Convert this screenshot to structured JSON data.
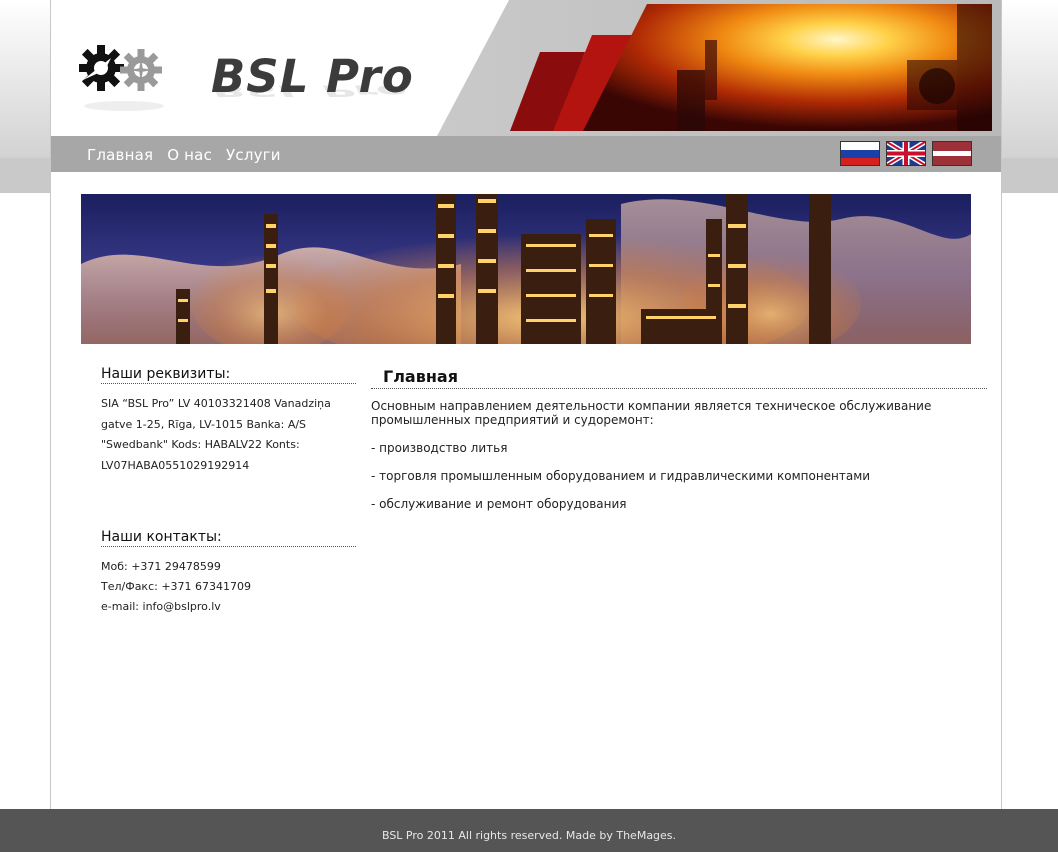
{
  "brand": {
    "name": "BSL Pro"
  },
  "nav": {
    "items": [
      {
        "label": "Главная"
      },
      {
        "label": "О нас"
      },
      {
        "label": "Услуги"
      }
    ]
  },
  "languages": [
    {
      "code": "ru",
      "icon": "flag-russia-icon"
    },
    {
      "code": "en",
      "icon": "flag-uk-icon"
    },
    {
      "code": "lv",
      "icon": "flag-latvia-icon"
    }
  ],
  "sidebar": {
    "requisites": {
      "title": "Наши реквизиты:",
      "line1": "SIA “BSL Pro” LV 40103321408 Vanadziņa",
      "line2": "gatve 1-25, Rīga, LV-1015 Banka: A/S",
      "line3": "\"Swedbank\" Kods: HABALV22 Konts:",
      "line4": "LV07HABA0551029192914"
    },
    "contacts": {
      "title": "Наши контакты:",
      "mobile": "Моб: +371 29478599",
      "phone_fax": "Тел/Факс: +371 67341709",
      "email": "e-mail: info@bslpro.lv"
    }
  },
  "main": {
    "title": "Главная",
    "intro": "Основным направлением деятельности компании является техническое обслуживание промышленных предприятий и судоремонт:",
    "items": [
      "- производство литья",
      "- торговля промышленным оборудованием и гидравлическими компонентами",
      "- обслуживание и ремонт оборудования"
    ]
  },
  "footer": {
    "text": "BSL Pro 2011 All rights reserved. Made by TheMages."
  },
  "colors": {
    "nav_bar": "#a7a7a7",
    "footer_bg": "#555555",
    "accent_red": "#b01010"
  }
}
